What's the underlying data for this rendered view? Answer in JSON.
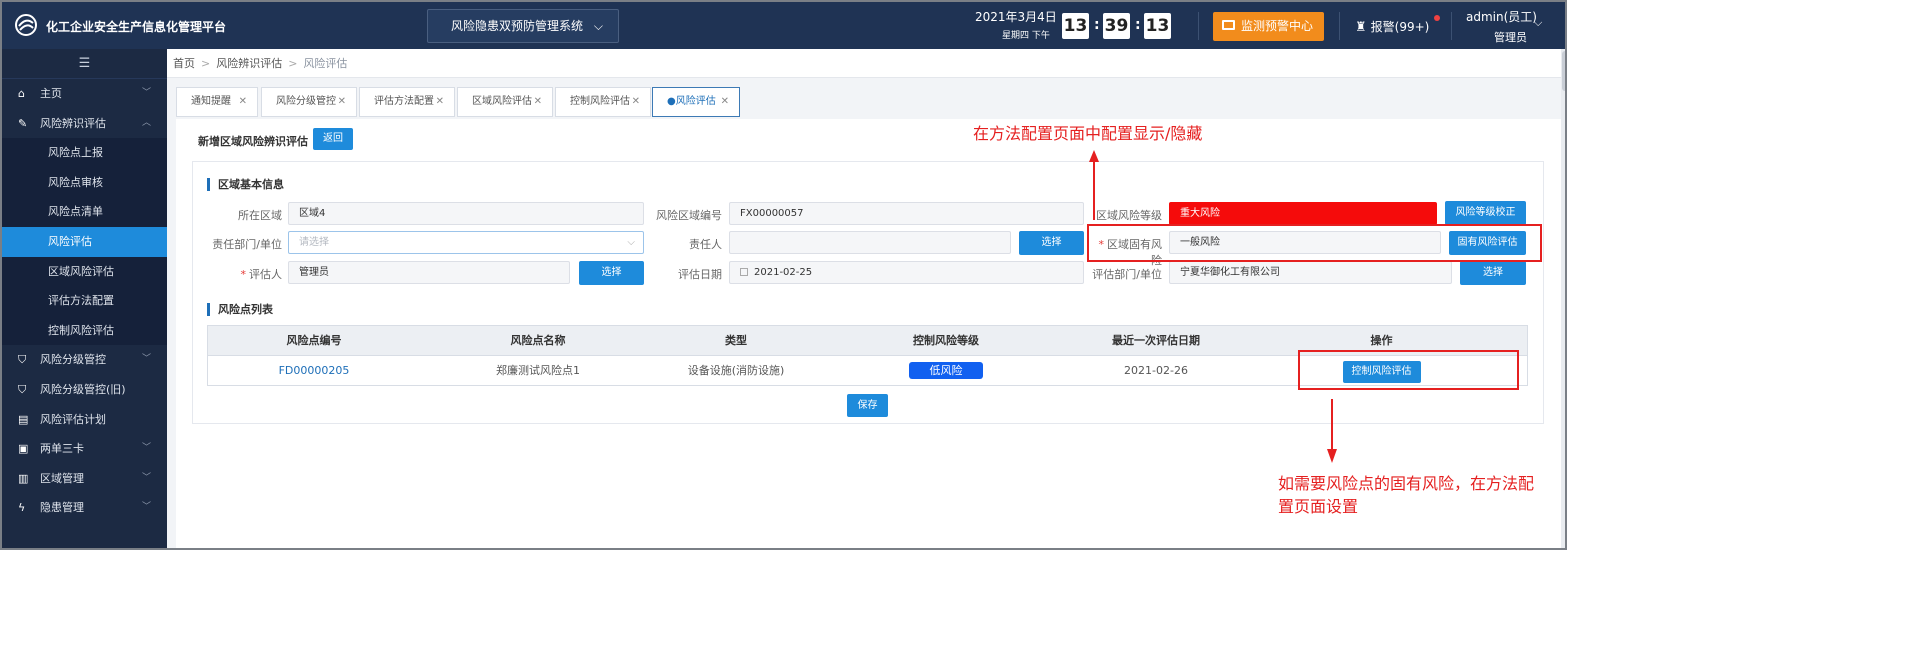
{
  "header": {
    "app_title": "化工企业安全生产信息化管理平台",
    "system_select": "风险隐患双预防管理系统",
    "date": "2021年3月4日",
    "weekday": "星期四 下午",
    "clock": {
      "h": "13",
      "m": "39",
      "s": "13"
    },
    "monitor_label": "监测预警中心",
    "alarm_label": "报警(99+)",
    "user_name": "admin(员工)",
    "user_role": "管理员"
  },
  "sidebar": {
    "items": [
      {
        "label": "主页",
        "icon": "home-icon"
      },
      {
        "label": "风险辨识评估",
        "icon": "edit-icon"
      },
      {
        "label": "风险点上报"
      },
      {
        "label": "风险点审核"
      },
      {
        "label": "风险点清单"
      },
      {
        "label": "风险评估"
      },
      {
        "label": "区域风险评估"
      },
      {
        "label": "评估方法配置"
      },
      {
        "label": "控制风险评估"
      },
      {
        "label": "风险分级管控",
        "icon": "shield-icon"
      },
      {
        "label": "风险分级管控(旧)",
        "icon": "shield-icon"
      },
      {
        "label": "风险评估计划",
        "icon": "document-icon"
      },
      {
        "label": "两单三卡",
        "icon": "clipboard-icon"
      },
      {
        "label": "区域管理",
        "icon": "bars-icon"
      },
      {
        "label": "隐患管理",
        "icon": "lightning-icon"
      }
    ]
  },
  "breadcrumb": [
    "首页",
    "风险辨识评估",
    "风险评估"
  ],
  "tabs": [
    "通知提醒",
    "风险分级管控",
    "评估方法配置",
    "区域风险评估",
    "控制风险评估",
    "●风险评估"
  ],
  "page": {
    "title": "新增区域风险辨识评估",
    "back_label": "返回",
    "section_basic": "区域基本信息",
    "section_list": "风险点列表",
    "save_label": "保存"
  },
  "form": {
    "area_label": "所在区域",
    "area_value": "区域4",
    "code_label": "风险区域编号",
    "code_value": "FX00000057",
    "level_label": "区域风险等级",
    "level_value": "重大风险",
    "level_btn": "风险等级校正",
    "dept_label": "责任部门/单位",
    "dept_placeholder": "请选择",
    "owner_label": "责任人",
    "owner_btn": "选择",
    "inherent_label": "区域固有风险",
    "inherent_value": "一般风险",
    "inherent_btn": "固有风险评估",
    "assessor_label": "评估人",
    "assessor_value": "管理员",
    "assessor_btn": "选择",
    "date_label": "评估日期",
    "date_value": "2021-02-25",
    "eval_dept_label": "评估部门/单位",
    "eval_dept_value": "宁夏华御化工有限公司",
    "eval_dept_btn": "选择"
  },
  "table": {
    "columns": [
      "风险点编号",
      "风险点名称",
      "类型",
      "控制风险等级",
      "最近一次评估日期",
      "操作"
    ],
    "rows": [
      {
        "code": "FD00000205",
        "name": "郑廉测试风险点1",
        "type": "设备设施(消防设施)",
        "level": "低风险",
        "date": "2021-02-26",
        "action": "控制风险评估"
      }
    ]
  },
  "annotations": {
    "top_note": "在方法配置页面中配置显示/隐藏",
    "bottom_note_1": "如需要风险点的固有风险，在方法配",
    "bottom_note_2": "置页面设置"
  },
  "colors": {
    "nav": "#1f3354",
    "sidebar": "#1c2a43",
    "accent": "#1e8bdb",
    "danger": "#f50b0b",
    "low": "#1160f0",
    "annotation": "#e52020",
    "monitor": "#f28c1c"
  }
}
